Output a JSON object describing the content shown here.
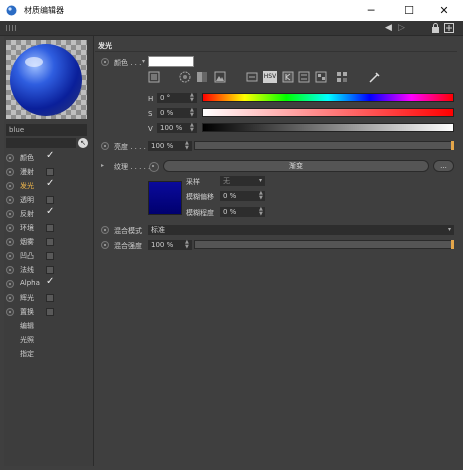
{
  "window": {
    "title": "材质编辑器",
    "minimize": "─",
    "maximize": "☐",
    "close": "✕"
  },
  "toolbar": {
    "back_icon": "◀",
    "forward_icon": "▷",
    "lock_icon": "🔒",
    "expand_icon": "⊞"
  },
  "material": {
    "name": "blue",
    "pick_icon": "↖"
  },
  "channels": [
    {
      "label": "颜色",
      "checked": true,
      "active": false
    },
    {
      "label": "漫射",
      "checked": false,
      "active": false
    },
    {
      "label": "发光",
      "checked": true,
      "active": true
    },
    {
      "label": "透明",
      "checked": false,
      "active": false
    },
    {
      "label": "反射",
      "checked": true,
      "active": false
    },
    {
      "label": "环境",
      "checked": false,
      "active": false
    },
    {
      "label": "烟雾",
      "checked": false,
      "active": false
    },
    {
      "label": "凹凸",
      "checked": false,
      "active": false
    },
    {
      "label": "法线",
      "checked": false,
      "active": false
    },
    {
      "label": "Alpha",
      "checked": true,
      "active": false
    },
    {
      "label": "辉光",
      "checked": false,
      "active": false
    },
    {
      "label": "置换",
      "checked": false,
      "active": false
    }
  ],
  "extra_items": [
    "编辑",
    "光照",
    "指定"
  ],
  "panel": {
    "section": "发光",
    "color_label": "颜色 . . .",
    "h_label": "H",
    "h_value": "0 °",
    "s_label": "S",
    "s_value": "0 %",
    "v_label": "V",
    "v_value": "100 %",
    "brightness_label": "亮度 . . . . .",
    "brightness_value": "100 %",
    "texture_label": "纹理 . . . . .",
    "texture_button": "渐变",
    "texture_more": "...",
    "sampling_label": "采样",
    "sampling_value": "无",
    "blur_offset_label": "模糊偏移",
    "blur_offset_value": "0 %",
    "blur_scale_label": "模糊程度",
    "blur_scale_value": "0 %",
    "mix_mode_label": "混合模式",
    "mix_mode_value": "标准",
    "mix_strength_label": "混合强度",
    "mix_strength_value": "100 %",
    "hsv_label": "HSV"
  },
  "colors": {
    "accent": "#f2b84b",
    "swatch": "#ffffff",
    "texture_preview": "#0a0a9c",
    "slider_end": "#e5a64a"
  }
}
